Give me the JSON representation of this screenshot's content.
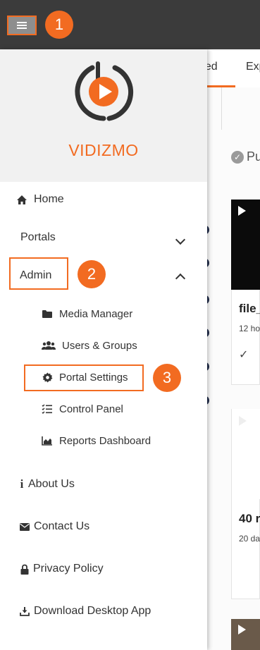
{
  "callouts": [
    "1",
    "2",
    "3"
  ],
  "brand": {
    "name": "VIDIZMO"
  },
  "background_page": {
    "tabs": [
      "hed",
      "Exp"
    ],
    "status_label": "Pu",
    "cards": [
      {
        "title": "file_",
        "meta": "12 ho"
      },
      {
        "title": "40 r",
        "meta": "20 da"
      }
    ]
  },
  "menu": {
    "home": "Home",
    "portals": "Portals",
    "admin": "Admin",
    "admin_items": {
      "media_manager": "Media Manager",
      "users_groups": "Users & Groups",
      "portal_settings": "Portal Settings",
      "control_panel": "Control Panel",
      "reports_dashboard": "Reports Dashboard"
    },
    "about_us": "About Us",
    "contact_us": "Contact Us",
    "privacy_policy": "Privacy Policy",
    "download_app": "Download Desktop App"
  },
  "colors": {
    "accent": "#f26b21",
    "topbar": "#3b3b3b",
    "drawer_header": "#f1f1f1"
  }
}
